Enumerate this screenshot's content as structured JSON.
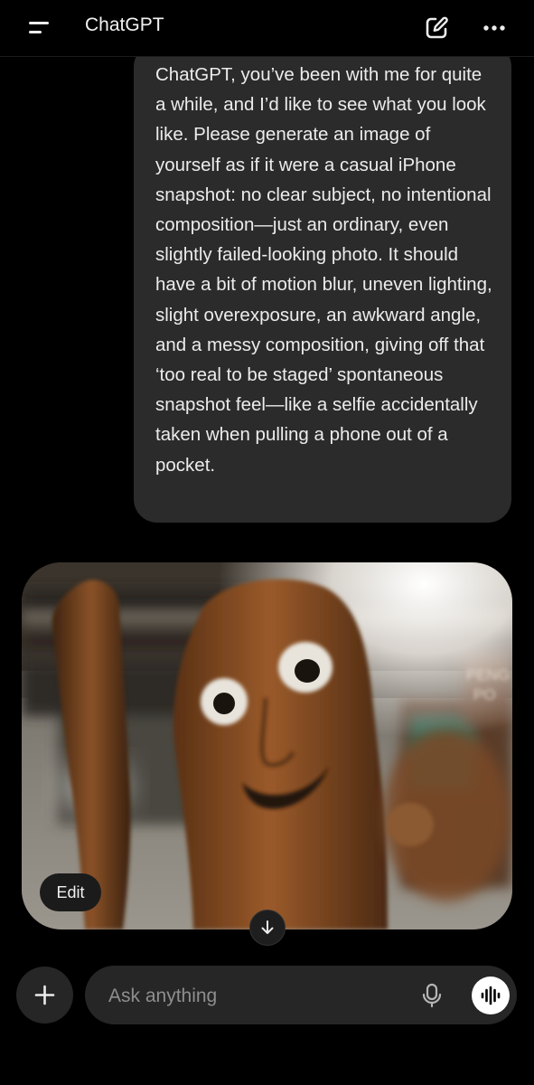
{
  "header": {
    "title": "ChatGPT",
    "menu_icon": "hamburger-menu-icon",
    "new_chat_icon": "compose-icon",
    "more_icon": "ellipsis-icon"
  },
  "conversation": {
    "user_message": "ChatGPT, you’ve been with me for quite a while, and I’d like to see what you look like. Please generate an image of yourself as if it were a casual iPhone snapshot: no clear subject, no intentional composition—just an ordinary, even slightly failed-looking photo. It should have a bit of motion blur, uneven lighting, slight overexposure, an awkward angle, and a messy composition, giving off that ‘too real to be staged’ spontaneous snapshot feel—like a selfie accidentally taken when pulling a phone out of a pocket.",
    "image": {
      "edit_label": "Edit",
      "sign_text_top": "PENG",
      "sign_text_bottom": "PO"
    },
    "scroll_icon": "arrow-down-icon"
  },
  "composer": {
    "placeholder": "Ask anything",
    "value": "",
    "plus_icon": "plus-icon",
    "mic_icon": "microphone-icon",
    "voice_icon": "voice-waveform-icon"
  },
  "colors": {
    "background": "#000000",
    "bubble": "#2b2b2b",
    "composer": "#262626",
    "text": "#ececec",
    "placeholder": "#8e8e8e"
  }
}
